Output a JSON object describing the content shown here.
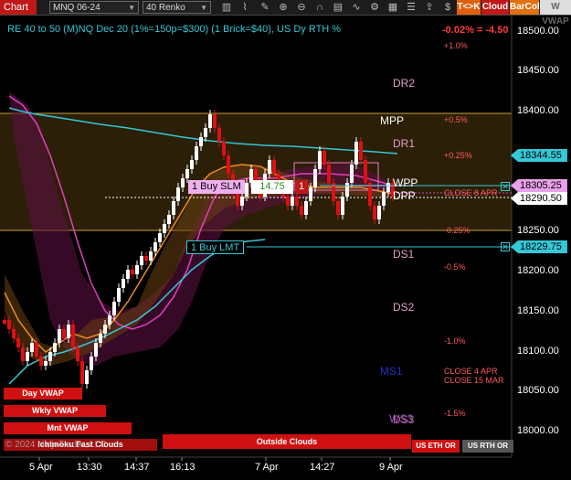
{
  "toolbar": {
    "chart_tab": "Chart",
    "instrument": "MNQ 06-24",
    "period": "40 Renko",
    "tk_label": "T<>K",
    "cloud_label": "Cloud",
    "barcol_label": "BarCol",
    "vwap_label": "VWAP",
    "icons": [
      "bar-chart-icon",
      "drawing-tools-icon",
      "pencil-icon",
      "zoom-in-icon",
      "zoom-out-icon",
      "magnet-icon",
      "data-box-icon",
      "indicators-icon",
      "strategies-icon",
      "template-icon",
      "properties-icon",
      "share-icon",
      "alert-icon",
      "dollar-icon"
    ]
  },
  "header": {
    "info": "RE 40 to 50 (M)NQ Dec 20 (1%=150p=$300) (1 Brick=$40), US Dy RTH %",
    "change": "-0.02% = -4.50"
  },
  "colors": {
    "accent_cyan": "#35c8d6",
    "sell_red": "#d01010",
    "buy_pink": "#e8a0e8",
    "pivot_pink": "#e0a0c0",
    "mpp_white": "#ffffff",
    "band_gold": "#c9a035"
  },
  "price_axis": {
    "ticks": [
      "18500.00",
      "18450.00",
      "18400.00",
      "18350.00",
      "18300.00",
      "18250.00",
      "18200.00",
      "18150.00",
      "18100.00",
      "18050.00",
      "18000.00"
    ],
    "tags": [
      {
        "label": "18344.55",
        "color": "#35c8d6"
      },
      {
        "label": "18305.25",
        "color": "#e8a0e8"
      },
      {
        "label": "18290.50",
        "color": "#ffffff"
      },
      {
        "label": "18229.75",
        "color": "#35c8d6"
      }
    ]
  },
  "time_axis": [
    "5 Apr",
    "13:30",
    "14:37",
    "16:13",
    "7 Apr",
    "14:27",
    "9 Apr"
  ],
  "pivot_levels": {
    "dr2": "DR2",
    "dr1": "DR1",
    "mpp": "MPP",
    "wpp": "WPP",
    "dpp": "DPP",
    "ds1": "DS1",
    "ds2": "DS2",
    "ms1": "MS1",
    "ws3": "WS3",
    "ds3": "DS3"
  },
  "pct_levels": [
    "+1.0%",
    "+0.5%",
    "+0.25%",
    "-0.25%",
    "-0.5%",
    "-1.0%",
    "-1.5%"
  ],
  "close_labels": {
    "close_apr8": "CLOSE 8 APR",
    "close_apr4": "CLOSE 4 APR",
    "close_mar15": "CLOSE 15 MAR"
  },
  "orders": {
    "buy_slm_label": "1 Buy SLM",
    "buy_slm_value": "14.75",
    "buy_slm_qty": "1",
    "buy_lmt_label": "1 Buy LMT",
    "cancel": "✕"
  },
  "bottom_labels": {
    "day_vwap": "Day VWAP",
    "wkly_vwap": "Wkly VWAP",
    "mnt_vwap": "Mnt VWAP",
    "ichimoku": "Ichimoku Fast Clouds",
    "copyright": "© 2024 NinjaTrader, LLC",
    "outside_clouds": "Outside Clouds",
    "us_eth": "US ETH OR",
    "us_rth": "US RTH OR"
  }
}
